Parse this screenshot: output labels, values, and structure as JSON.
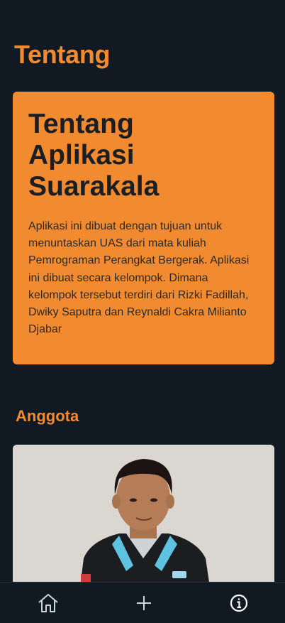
{
  "header": {
    "title": "Tentang"
  },
  "about": {
    "title": "Tentang Aplikasi Suarakala",
    "description": "Aplikasi ini dibuat dengan tujuan untuk menuntaskan UAS dari mata kuliah Pemrograman Perangkat Bergerak. Aplikasi ini dibuat secara kelompok. Dimana kelompok tersebut terdiri dari Rizki Fadillah, Dwiky Saputra dan Reynaldi Cakra Milianto Djabar"
  },
  "members": {
    "title": "Anggota"
  },
  "nav": {
    "items": [
      "home-icon",
      "plus-icon",
      "info-icon"
    ]
  },
  "colors": {
    "accent": "#f28a30",
    "background": "#111a22",
    "card_text": "#1b1f24"
  }
}
